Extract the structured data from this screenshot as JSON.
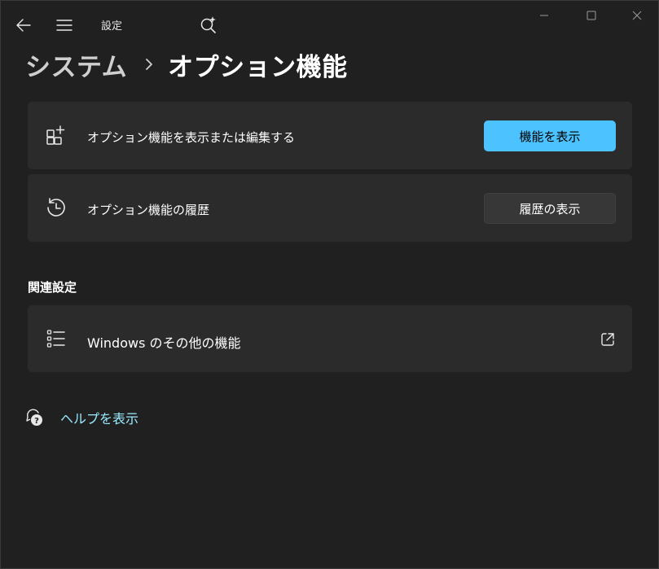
{
  "app": {
    "title": "設定"
  },
  "breadcrumb": {
    "parent": "システム",
    "current": "オプション機能"
  },
  "cards": {
    "optional_features": {
      "label": "オプション機能を表示または編集する",
      "button_label": "機能を表示",
      "icon": "add-app-icon"
    },
    "history": {
      "label": "オプション機能の履歴",
      "button_label": "履歴の表示",
      "icon": "history-icon"
    }
  },
  "related": {
    "heading": "関連設定",
    "windows_features": {
      "label": "Windows のその他の機能",
      "icon": "list-icon"
    }
  },
  "help": {
    "label": "ヘルプを表示"
  },
  "colors": {
    "accent": "#4cc2ff",
    "link": "#99ebff",
    "background": "#202020",
    "card": "#2b2b2b"
  }
}
